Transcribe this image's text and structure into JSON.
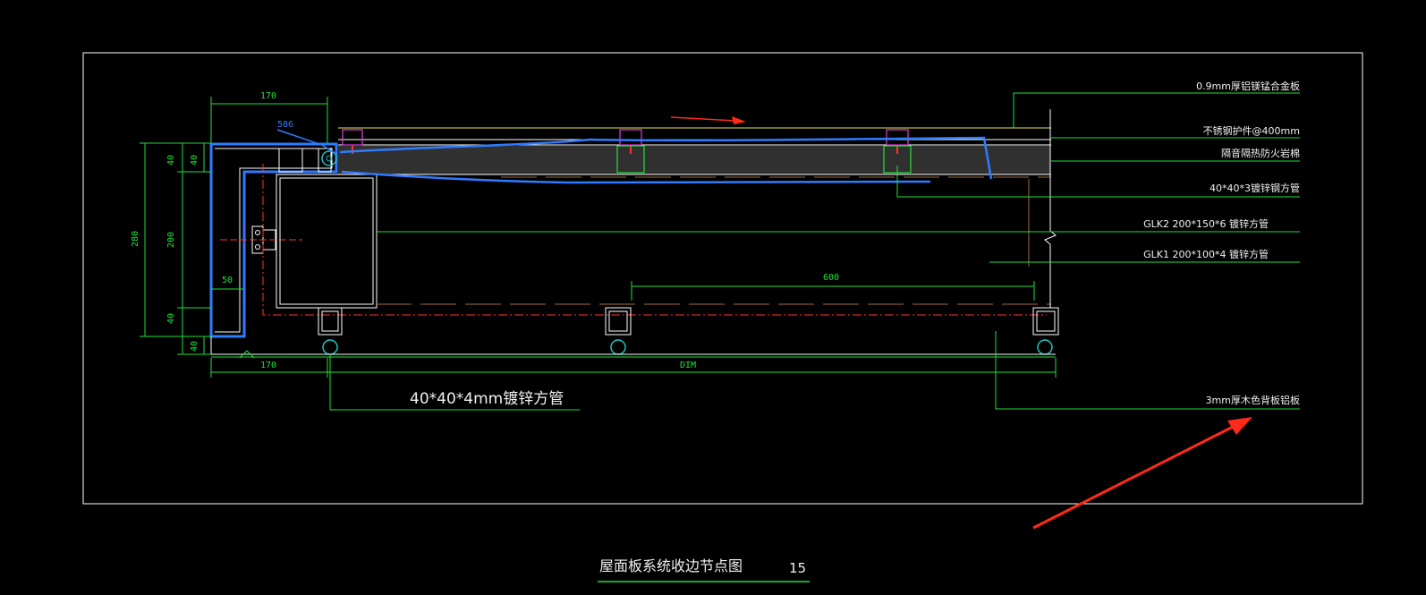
{
  "drawing": {
    "title": "屋面板系统收边节点图",
    "sheet_number": "15"
  },
  "callouts": {
    "c1": "0.9mm厚铝镁锰合金板",
    "c2": "不锈钢护件@400mm",
    "c3": "隔音隔热防火岩棉",
    "c4": "40*40*3镀锌钢方管",
    "c5": "GLK2  200*150*6  镀锌方管",
    "c6": "GLK1  200*100*4  镀锌方管",
    "c7": "3mm厚木色背板铝板",
    "tube_label": "40*40*4mm镀锌方管"
  },
  "dimensions": {
    "top_width": "170",
    "bottom_width": "170",
    "overall": "DIM",
    "spacing": "600",
    "lip": "50",
    "total_height": "280",
    "top_flange": "40",
    "top_flange_2": "40",
    "web": "200",
    "bottom_flange": "40",
    "bottom_flange_2": "40",
    "note_blue": "586"
  },
  "colors": {
    "background": "#000000",
    "frame": "#ffffff",
    "dimension": "#22e03a",
    "outline": "#2f7bff",
    "fastener": "#e040e0",
    "axis": "#ff3030",
    "arrow": "#ff2a1a"
  }
}
